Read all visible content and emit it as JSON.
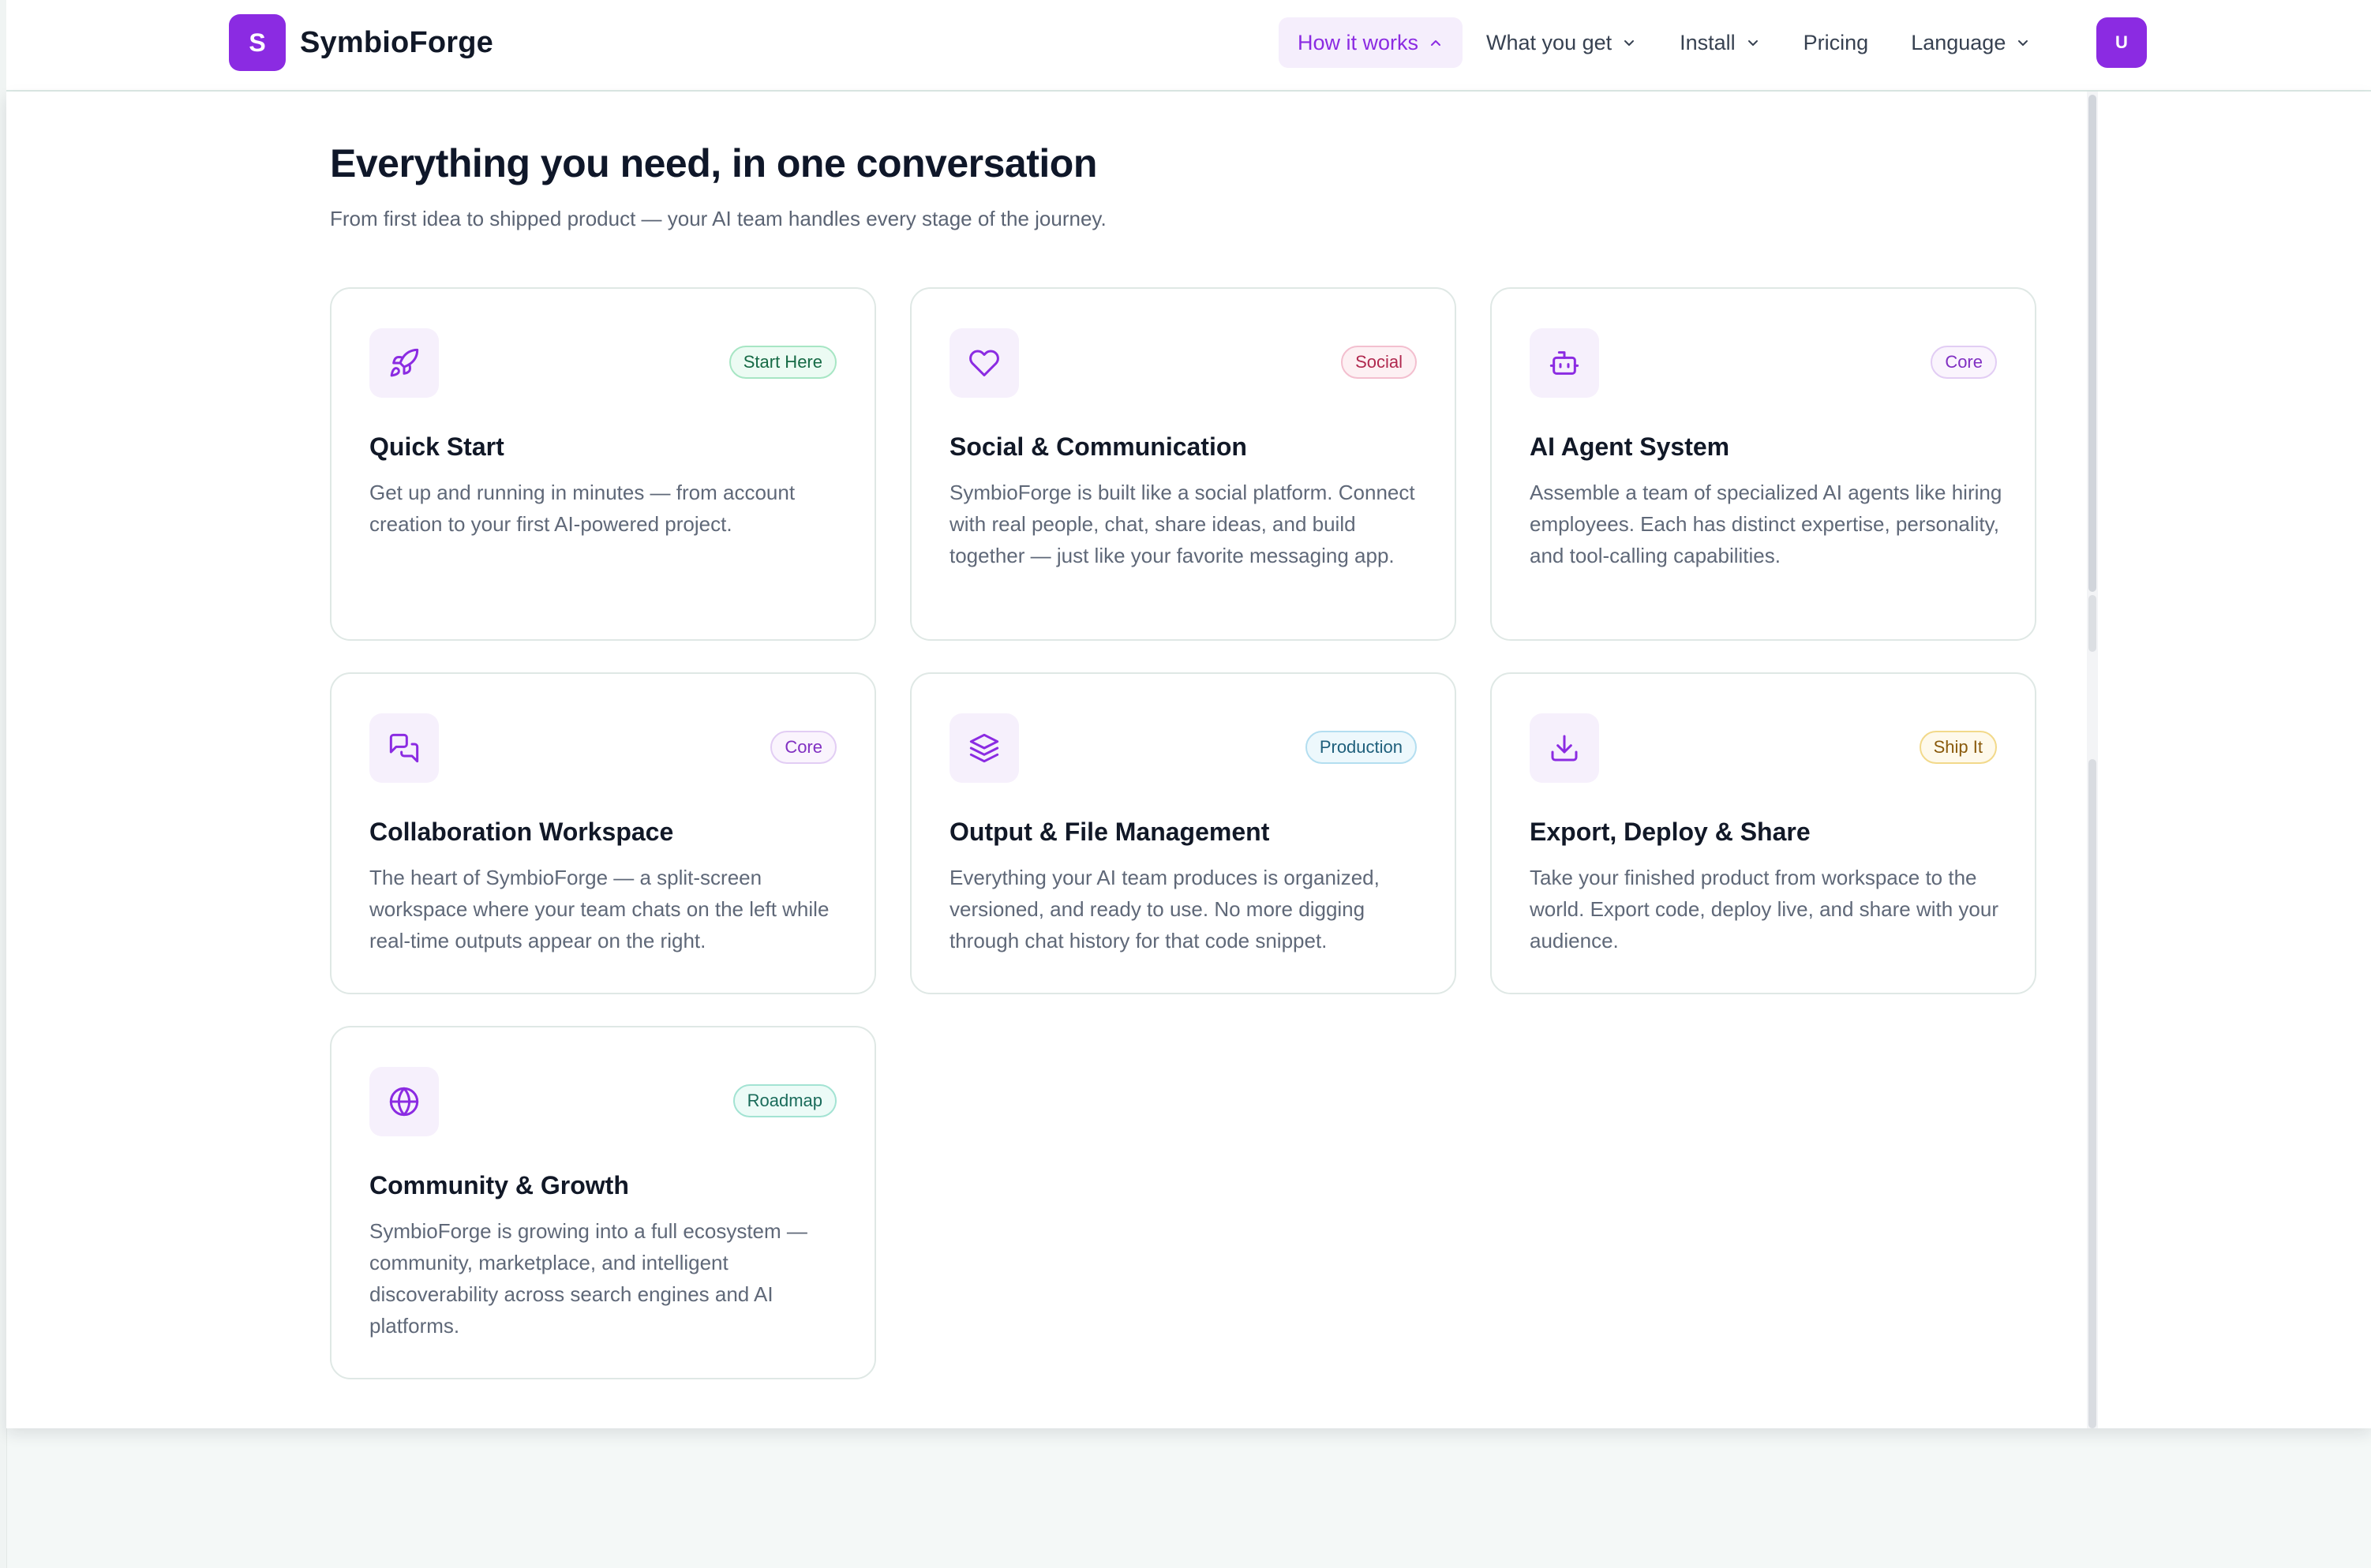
{
  "brand": {
    "logo_letter": "S",
    "name": "SymbioForge"
  },
  "nav": {
    "items": [
      {
        "label": "How it works",
        "active": true,
        "chevron": "chevron-up-icon"
      },
      {
        "label": "What you get",
        "active": false,
        "chevron": "chevron-down-icon"
      },
      {
        "label": "Install",
        "active": false,
        "chevron": "chevron-down-icon"
      },
      {
        "label": "Pricing",
        "active": false,
        "chevron": null
      },
      {
        "label": "Language",
        "active": false,
        "chevron": "chevron-down-icon"
      }
    ],
    "user_initial": "U"
  },
  "main": {
    "title": "Everything you need, in one conversation",
    "subtitle": "From first idea to shipped product — your AI team handles every stage of the journey.",
    "cards": [
      {
        "icon": "rocket-icon",
        "badge": "Start Here",
        "badge_color": "#166a45",
        "title": "Quick Start",
        "description": "Get up and running in minutes — from account creation to your first AI-powered project."
      },
      {
        "icon": "heart-icon",
        "badge": "Social",
        "badge_color": "#b0294f",
        "title": "Social & Communication",
        "description": "SymbioForge is built like a social platform. Connect with real people, chat, share ideas, and build together — just like your favorite messaging app."
      },
      {
        "icon": "bot-icon",
        "badge": "Core",
        "badge_color": "#8130c2",
        "title": "AI Agent System",
        "description": "Assemble a team of specialized AI agents like hiring employees. Each has distinct expertise, personality, and tool-calling capabilities."
      },
      {
        "icon": "chat-bubbles-icon",
        "badge": "Core",
        "badge_color": "#8130c2",
        "title": "Collaboration Workspace",
        "description": "The heart of SymbioForge — a split-screen workspace where your team chats on the left while real-time outputs appear on the right."
      },
      {
        "icon": "layers-icon",
        "badge": "Production",
        "badge_color": "#1e5f7b",
        "title": "Output & File Management",
        "description": "Everything your AI team produces is organized, versioned, and ready to use. No more digging through chat history for that code snippet."
      },
      {
        "icon": "download-icon",
        "badge": "Ship It",
        "badge_color": "#8a5a0c",
        "title": "Export, Deploy & Share",
        "description": "Take your finished product from workspace to the world. Export code, deploy live, and share with your audience."
      },
      {
        "icon": "globe-icon",
        "badge": "Roadmap",
        "badge_color": "#1a6b5a",
        "title": "Community & Growth",
        "description": "SymbioForge is growing into a full ecosystem — community, marketplace, and intelligent discoverability across search engines and AI platforms."
      }
    ]
  },
  "colors": {
    "accent": "#8b2be2",
    "active_nav_bg": "#f5eefc",
    "card_border": "#dfe8e5",
    "page_bg": "#f4f8f7"
  }
}
